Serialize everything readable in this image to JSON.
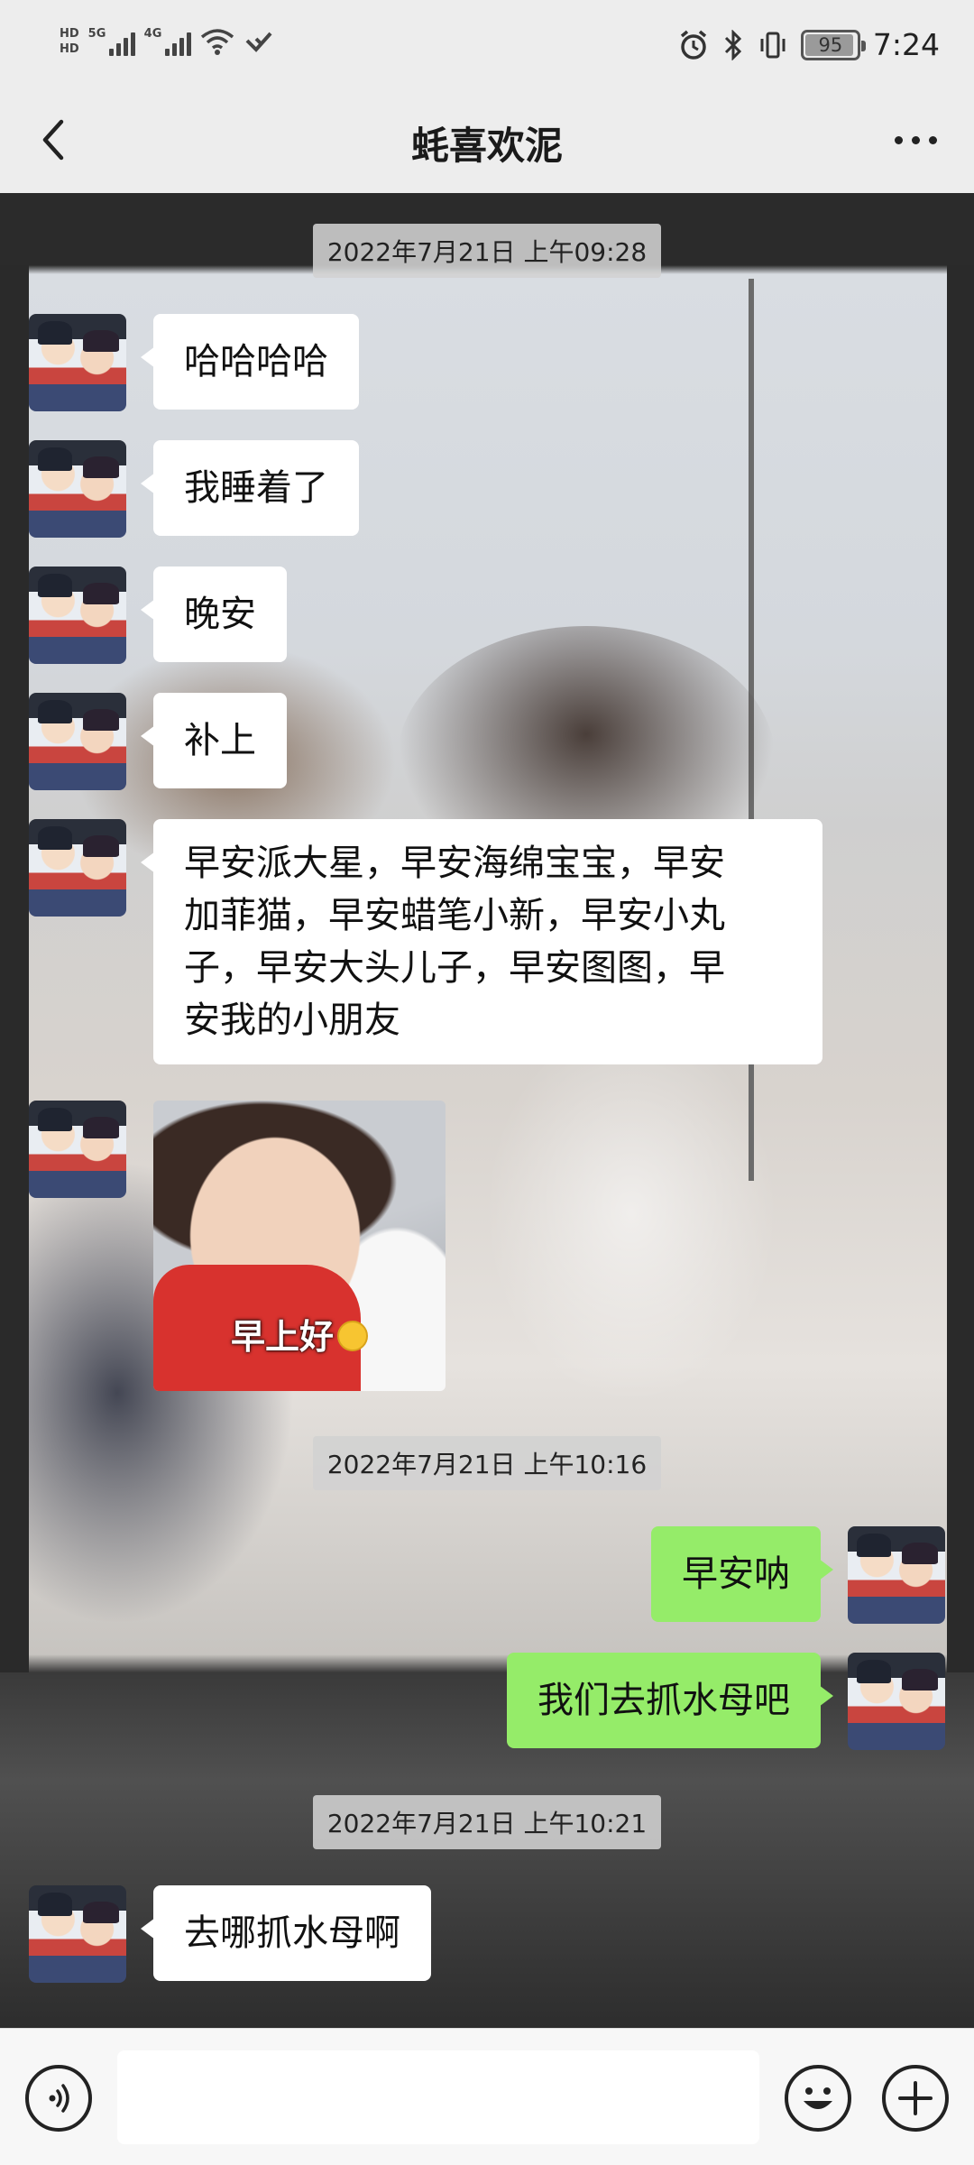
{
  "status_bar": {
    "hd_top": "HD",
    "hd_bottom": "HD",
    "net1_label": "5G",
    "net2_label": "4G",
    "battery_level": "95",
    "time": "7:24"
  },
  "header": {
    "title": "蚝喜欢泥"
  },
  "messages": [
    {
      "type": "timestamp",
      "text": "2022年7月21日 上午09:28"
    },
    {
      "type": "text",
      "direction": "in",
      "text": "哈哈哈哈"
    },
    {
      "type": "text",
      "direction": "in",
      "text": "我睡着了"
    },
    {
      "type": "text",
      "direction": "in",
      "text": "晚安"
    },
    {
      "type": "text",
      "direction": "in",
      "text": "补上"
    },
    {
      "type": "text",
      "direction": "in",
      "lines": [
        "早安派大星，早安海绵宝宝，早安",
        "加菲猫，早安蜡笔小新，早安小丸",
        "子，早安大头儿子，早安图图，早",
        "安我的小朋友"
      ]
    },
    {
      "type": "sticker",
      "direction": "in",
      "caption": "早上好"
    },
    {
      "type": "timestamp",
      "text": "2022年7月21日 上午10:16"
    },
    {
      "type": "text",
      "direction": "out",
      "text": "早安呐"
    },
    {
      "type": "text",
      "direction": "out",
      "text": "我们去抓水母吧"
    },
    {
      "type": "timestamp",
      "text": "2022年7月21日 上午10:21"
    },
    {
      "type": "text",
      "direction": "in",
      "text": "去哪抓水母啊"
    }
  ],
  "input_bar": {
    "placeholder": ""
  },
  "icons": {
    "back": "chevron-left-icon",
    "more": "more-dots-icon",
    "voice": "voice-icon",
    "emoji": "emoji-icon",
    "plus": "plus-icon"
  },
  "colors": {
    "outgoing_bubble": "#95ec69",
    "incoming_bubble": "#ffffff",
    "header_bg": "#ededed"
  }
}
